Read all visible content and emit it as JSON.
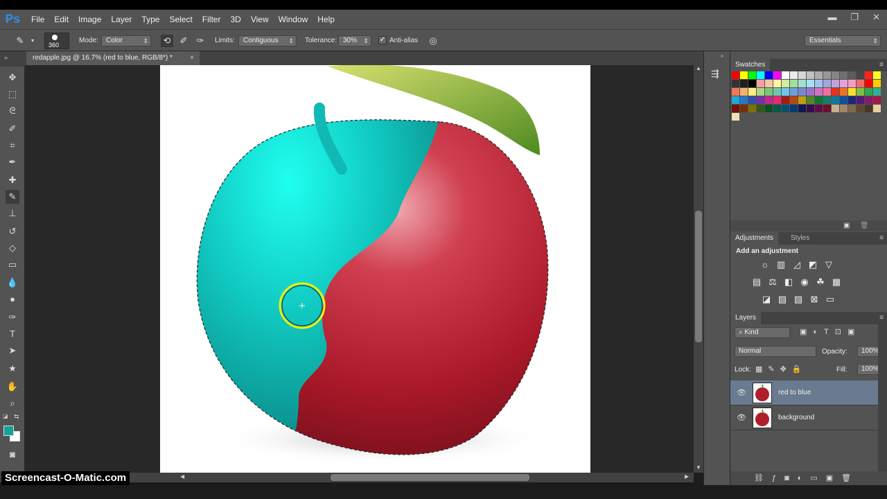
{
  "app": {
    "logo": "Ps"
  },
  "menu": [
    "File",
    "Edit",
    "Image",
    "Layer",
    "Type",
    "Select",
    "Filter",
    "3D",
    "View",
    "Window",
    "Help"
  ],
  "window_controls": {
    "minimize": "▬",
    "restore": "❐",
    "close": "✕"
  },
  "options": {
    "brush_size": "360",
    "mode_label": "Mode:",
    "mode_value": "Color",
    "limits_label": "Limits:",
    "limits_value": "Contiguous",
    "tolerance_label": "Tolerance:",
    "tolerance_value": "30%",
    "antialias_label": "Anti-alias",
    "workspace": "Essentials"
  },
  "document": {
    "tab_title": "redapple.jpg @ 16.7% (red to blue, RGB/8*) *",
    "close": "×"
  },
  "colors": {
    "foreground": "#14a39a",
    "background": "#ffffff",
    "accent": "#2f8ad8"
  },
  "swatches": {
    "tab": "Swatches",
    "colors": [
      "#ff0000",
      "#ffff00",
      "#00ff00",
      "#00ffff",
      "#0000ff",
      "#ff00ff",
      "#ffffff",
      "#ebebeb",
      "#d6d6d6",
      "#c2c2c2",
      "#adadad",
      "#999999",
      "#858585",
      "#707070",
      "#5c5c5c",
      "#474747",
      "#ff2020",
      "#ffff20",
      "#333333",
      "#1f1f1f",
      "#000000",
      "#f4a0a0",
      "#f5c7a0",
      "#fff5a0",
      "#d0eda0",
      "#a0e0a0",
      "#a0e0d0",
      "#a0e4f4",
      "#a0c4ec",
      "#a0a8e0",
      "#c4a0dc",
      "#e8a0dc",
      "#f4a0c4",
      "#f46c6c",
      "#ff0000",
      "#ffcc00",
      "#f07858",
      "#f8b070",
      "#fff080",
      "#a8d880",
      "#78c878",
      "#70c8b0",
      "#70c8e8",
      "#70a0dc",
      "#7888d0",
      "#a070c8",
      "#d070c0",
      "#f070a0",
      "#e83020",
      "#f07020",
      "#f8e030",
      "#80c040",
      "#30a848",
      "#30b090",
      "#20a8d8",
      "#2878c8",
      "#3050b0",
      "#7830a8",
      "#c02890",
      "#e82870",
      "#a81818",
      "#b84810",
      "#c0a010",
      "#508828",
      "#107830",
      "#108068",
      "#1078a0",
      "#1050a0",
      "#182878",
      "#501878",
      "#881868",
      "#a01848",
      "#701010",
      "#783008",
      "#807008",
      "#385818",
      "#085020",
      "#085848",
      "#085070",
      "#083870",
      "#101850",
      "#380c50",
      "#600c48",
      "#700c30",
      "#c8b090",
      "#a08868",
      "#806848",
      "#604830",
      "#483420",
      "#e8d0a0",
      "#f0e0b0"
    ],
    "menu": "≡"
  },
  "adjustments": {
    "tabs": [
      "Adjustments",
      "Styles"
    ],
    "heading": "Add an adjustment"
  },
  "layers": {
    "tab": "Layers",
    "filter": "Kind",
    "blend": "Normal",
    "opacity_label": "Opacity:",
    "opacity": "100%",
    "lock_label": "Lock:",
    "fill_label": "Fill:",
    "fill": "100%",
    "items": [
      {
        "name": "red to blue",
        "selected": true
      },
      {
        "name": "background",
        "selected": false
      }
    ]
  },
  "watermark": "Screencast-O-Matic.com"
}
